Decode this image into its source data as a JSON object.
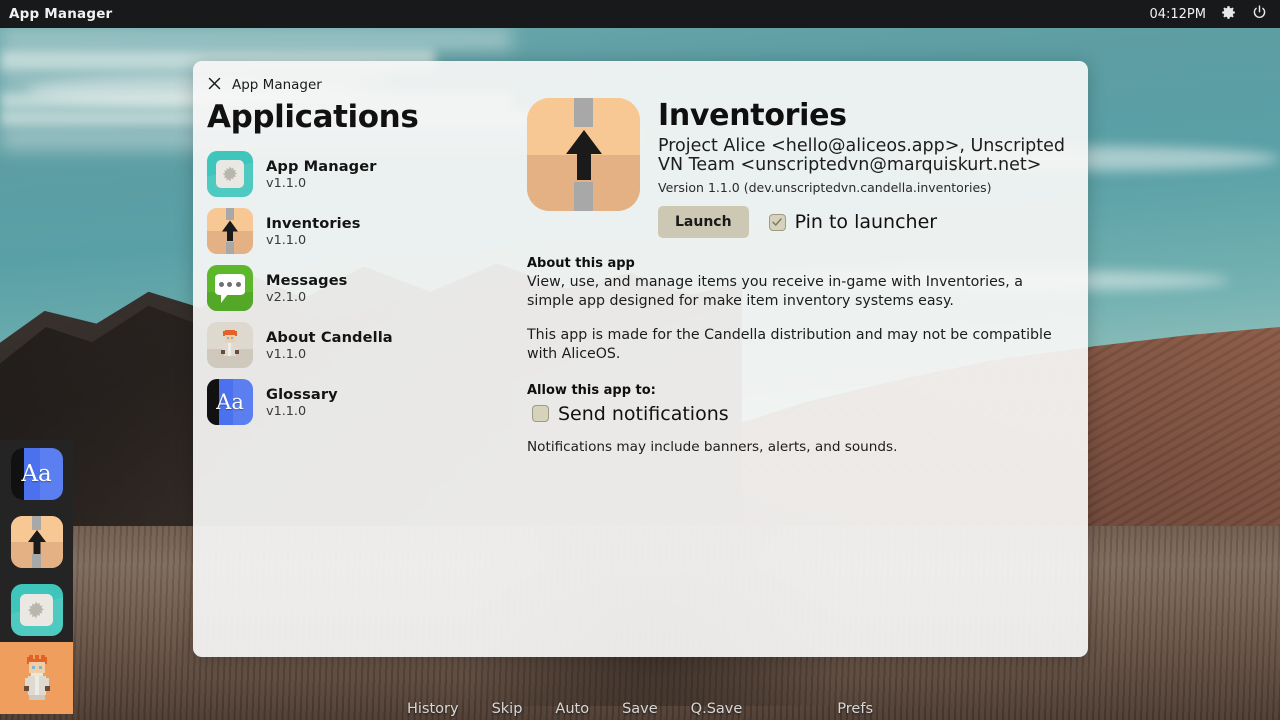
{
  "topbar": {
    "title": "App Manager",
    "clock": "04:12PM",
    "settings_icon": "gear-icon",
    "power_icon": "power-icon"
  },
  "window": {
    "close_icon": "close-icon",
    "title": "App Manager",
    "list_heading": "Applications",
    "apps": [
      {
        "name": "App Manager",
        "version": "v1.1.0",
        "icon": "app-manager-icon"
      },
      {
        "name": "Inventories",
        "version": "v1.1.0",
        "icon": "inventories-icon"
      },
      {
        "name": "Messages",
        "version": "v2.1.0",
        "icon": "messages-icon"
      },
      {
        "name": "About Candella",
        "version": "v1.1.0",
        "icon": "about-candella-icon"
      },
      {
        "name": "Glossary",
        "version": "v1.1.0",
        "icon": "glossary-icon"
      }
    ],
    "detail": {
      "icon": "inventories-icon",
      "title": "Inventories",
      "authors": "Project Alice <hello@aliceos.app>, Unscripted VN Team <unscriptedvn@marquiskurt.net>",
      "version_line": "Version 1.1.0 (dev.unscriptedvn.candella.inventories)",
      "launch_label": "Launch",
      "pin_label": "Pin to launcher",
      "pin_checked": true,
      "about_heading": "About this app",
      "about_paragraph_1": "View, use, and manage items you receive in-game with Inventories, a simple app designed for make item inventory systems easy.",
      "about_paragraph_2": "This app is made for the Candella distribution and may not be compatible with AliceOS.",
      "permissions_heading": "Allow this app to:",
      "permission_label": "Send notifications",
      "permission_checked": false,
      "permission_note": "Notifications may include banners, alerts, and sounds."
    }
  },
  "dock": {
    "items": [
      {
        "icon": "glossary-icon",
        "name": "Glossary"
      },
      {
        "icon": "inventories-icon",
        "name": "Inventories"
      },
      {
        "icon": "app-manager-icon",
        "name": "App Manager"
      },
      {
        "icon": "character-icon",
        "name": "Character"
      }
    ]
  },
  "quick_menu": {
    "items": [
      "History",
      "Skip",
      "Auto",
      "Save",
      "Q.Save",
      "Prefs"
    ]
  },
  "colors": {
    "topbar_bg": "#17191a",
    "window_bg": "#f6f6f5",
    "launch_button": "#cdc8b4",
    "app_manager_teal": "#3fc6bc",
    "inventories_tan": "#f3c08a",
    "messages_green": "#5cb82a",
    "glossary_blue": "#5b7ff0",
    "character_orange": "#ef9e5e"
  }
}
